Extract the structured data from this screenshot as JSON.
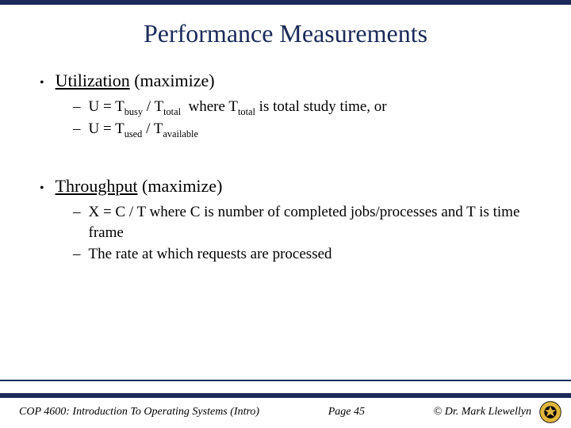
{
  "title": "Performance Measurements",
  "sections": [
    {
      "heading_underlined": "Utilization",
      "heading_rest": " (maximize)",
      "subs": [
        {
          "html": "U = T<sub>busy</sub> / T<sub>total</sub>&nbsp; where T<sub>total</sub> is total study time, or"
        },
        {
          "html": "U = T<sub>used</sub> / T<sub>available</sub>"
        }
      ]
    },
    {
      "heading_underlined": "Throughput",
      "heading_rest": " (maximize)",
      "subs": [
        {
          "html": "X = C / T where C is number of completed jobs/processes and T is time frame"
        },
        {
          "html": "The rate at which requests are processed"
        }
      ]
    }
  ],
  "footer": {
    "course": "COP 4600: Introduction To Operating Systems (Intro)",
    "page": "Page 45",
    "copyright": "© Dr. Mark Llewellyn"
  }
}
